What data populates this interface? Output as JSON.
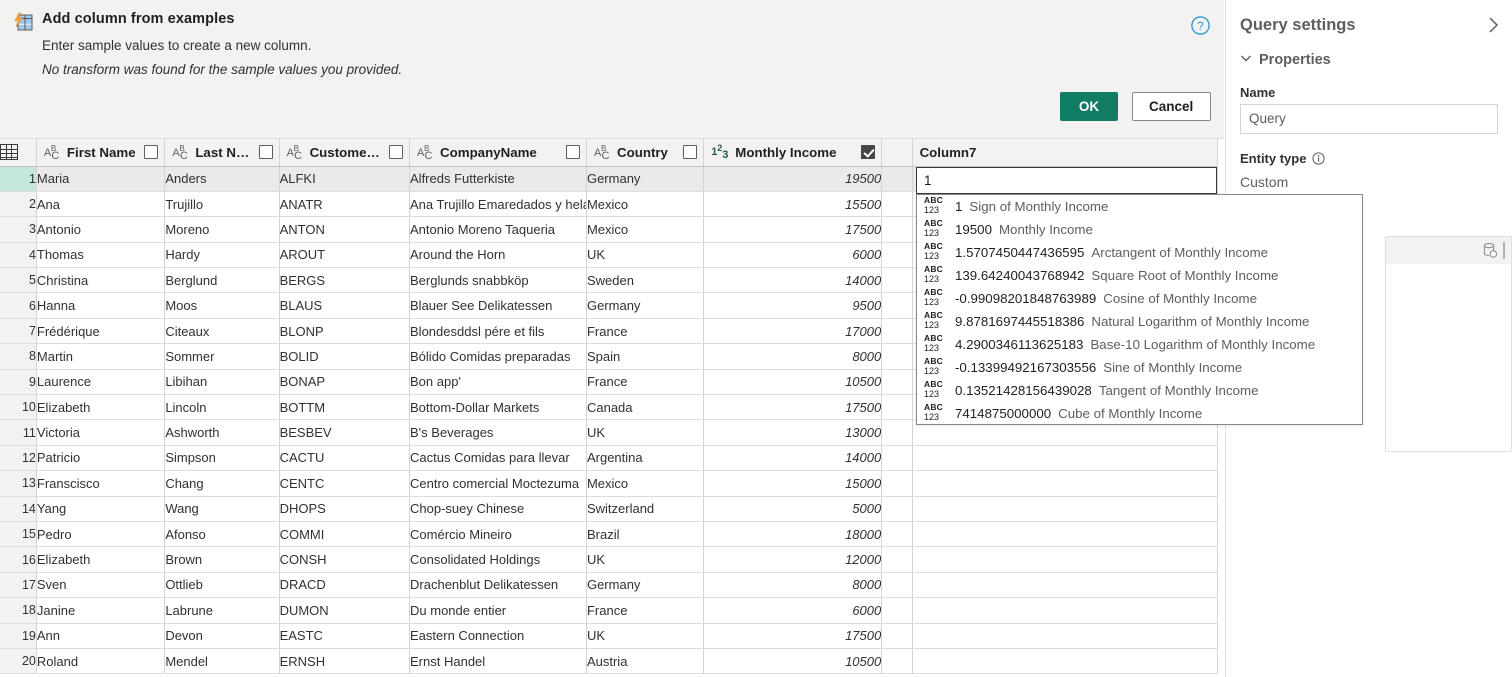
{
  "dialog": {
    "icon": "add-column-from-examples-icon",
    "title": "Add column from examples",
    "subtitle": "Enter sample values to create a new column.",
    "note": "No transform was found for the sample values you provided.",
    "help_icon": "help-circle-icon",
    "ok_label": "OK",
    "cancel_label": "Cancel",
    "ok_color": "#107c63"
  },
  "grid": {
    "corner_icon": "select-all-grid-icon",
    "columns": [
      {
        "name": "First Name",
        "type": "text",
        "type_icon": "abc-text-type-icon",
        "checkbox": false,
        "align": "left"
      },
      {
        "name": "Last Name",
        "type": "text",
        "type_icon": "abc-text-type-icon",
        "checkbox": false,
        "align": "left"
      },
      {
        "name": "CustomerID",
        "type": "text",
        "type_icon": "abc-text-type-icon",
        "checkbox": false,
        "align": "left"
      },
      {
        "name": "CompanyName",
        "type": "text",
        "type_icon": "abc-text-type-icon",
        "checkbox": false,
        "align": "left"
      },
      {
        "name": "Country",
        "type": "text",
        "type_icon": "abc-text-type-icon",
        "checkbox": false,
        "align": "left"
      },
      {
        "name": "Monthly Income",
        "type": "number",
        "type_icon": "123-number-type-icon",
        "checkbox": true,
        "align": "right",
        "selected": true
      }
    ],
    "new_column": {
      "name": "Column7",
      "value": "1"
    },
    "selected_header_color": "#9fd8c6",
    "rows": [
      {
        "n": "1",
        "first": "Maria",
        "last": "Anders",
        "id": "ALFKI",
        "company": "Alfreds Futterkiste",
        "country": "Germany",
        "income": "19500"
      },
      {
        "n": "2",
        "first": "Ana",
        "last": "Trujillo",
        "id": "ANATR",
        "company": "Ana Trujillo Emaredados y helados",
        "country": "Mexico",
        "income": "15500"
      },
      {
        "n": "3",
        "first": "Antonio",
        "last": "Moreno",
        "id": "ANTON",
        "company": "Antonio Moreno Taqueria",
        "country": "Mexico",
        "income": "17500"
      },
      {
        "n": "4",
        "first": "Thomas",
        "last": "Hardy",
        "id": "AROUT",
        "company": "Around the Horn",
        "country": "UK",
        "income": "6000"
      },
      {
        "n": "5",
        "first": "Christina",
        "last": "Berglund",
        "id": "BERGS",
        "company": "Berglunds snabbköp",
        "country": "Sweden",
        "income": "14000"
      },
      {
        "n": "6",
        "first": "Hanna",
        "last": "Moos",
        "id": "BLAUS",
        "company": "Blauer See Delikatessen",
        "country": "Germany",
        "income": "9500"
      },
      {
        "n": "7",
        "first": "Frédérique",
        "last": "Citeaux",
        "id": "BLONP",
        "company": "Blondesddsl pére et fils",
        "country": "France",
        "income": "17000"
      },
      {
        "n": "8",
        "first": "Martin",
        "last": "Sommer",
        "id": "BOLID",
        "company": "Bólido Comidas preparadas",
        "country": "Spain",
        "income": "8000"
      },
      {
        "n": "9",
        "first": "Laurence",
        "last": "Libihan",
        "id": "BONAP",
        "company": "Bon app'",
        "country": "France",
        "income": "10500"
      },
      {
        "n": "10",
        "first": "Elizabeth",
        "last": "Lincoln",
        "id": "BOTTM",
        "company": "Bottom-Dollar Markets",
        "country": "Canada",
        "income": "17500"
      },
      {
        "n": "11",
        "first": "Victoria",
        "last": "Ashworth",
        "id": "BESBEV",
        "company": "B's Beverages",
        "country": "UK",
        "income": "13000"
      },
      {
        "n": "12",
        "first": "Patricio",
        "last": "Simpson",
        "id": "CACTU",
        "company": "Cactus Comidas para llevar",
        "country": "Argentina",
        "income": "14000"
      },
      {
        "n": "13",
        "first": "Franscisco",
        "last": "Chang",
        "id": "CENTC",
        "company": "Centro comercial Moctezuma",
        "country": "Mexico",
        "income": "15000"
      },
      {
        "n": "14",
        "first": "Yang",
        "last": "Wang",
        "id": "DHOPS",
        "company": "Chop-suey Chinese",
        "country": "Switzerland",
        "income": "5000"
      },
      {
        "n": "15",
        "first": "Pedro",
        "last": "Afonso",
        "id": "COMMI",
        "company": "Comércio Mineiro",
        "country": "Brazil",
        "income": "18000"
      },
      {
        "n": "16",
        "first": "Elizabeth",
        "last": "Brown",
        "id": "CONSH",
        "company": "Consolidated Holdings",
        "country": "UK",
        "income": "12000"
      },
      {
        "n": "17",
        "first": "Sven",
        "last": "Ottlieb",
        "id": "DRACD",
        "company": "Drachenblut Delikatessen",
        "country": "Germany",
        "income": "8000"
      },
      {
        "n": "18",
        "first": "Janine",
        "last": "Labrune",
        "id": "DUMON",
        "company": "Du monde entier",
        "country": "France",
        "income": "6000"
      },
      {
        "n": "19",
        "first": "Ann",
        "last": "Devon",
        "id": "EASTC",
        "company": "Eastern Connection",
        "country": "UK",
        "income": "17500"
      },
      {
        "n": "20",
        "first": "Roland",
        "last": "Mendel",
        "id": "ERNSH",
        "company": "Ernst Handel",
        "country": "Austria",
        "income": "10500"
      }
    ]
  },
  "suggestions": {
    "type_icon": "abc-123-any-type-icon",
    "type_line1": "ABC",
    "type_line2": "123",
    "items": [
      {
        "value": "1",
        "desc": "Sign of Monthly Income"
      },
      {
        "value": "19500",
        "desc": "Monthly Income"
      },
      {
        "value": "1.5707450447436595",
        "desc": "Arctangent of Monthly Income"
      },
      {
        "value": "139.64240043768942",
        "desc": "Square Root of Monthly Income"
      },
      {
        "value": "-0.99098201848763989",
        "desc": "Cosine of Monthly Income"
      },
      {
        "value": "9.8781697445518386",
        "desc": "Natural Logarithm of Monthly Income"
      },
      {
        "value": "4.2900346113625183",
        "desc": "Base-10 Logarithm of Monthly Income"
      },
      {
        "value": "-0.13399492167303556",
        "desc": "Sine of Monthly Income"
      },
      {
        "value": "0.13521428156439028",
        "desc": "Tangent of Monthly Income"
      },
      {
        "value": "7414875000000",
        "desc": "Cube of Monthly Income"
      }
    ]
  },
  "query_settings": {
    "title": "Query settings",
    "collapse_icon": "chevron-right-icon",
    "section_label": "Properties",
    "section_caret": "chevron-down-icon",
    "name_label": "Name",
    "name_value": "Query",
    "entity_type_label": "Entity type",
    "entity_info_icon": "info-circle-icon",
    "entity_type_value": "Custom",
    "step_icon": "database-source-icon"
  }
}
